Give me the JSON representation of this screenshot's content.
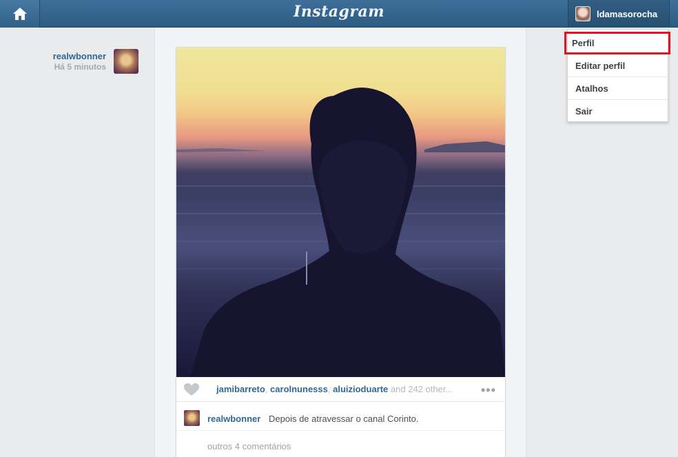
{
  "header": {
    "brand": "Instagram",
    "home_icon": "home-icon",
    "username": "ldamasorocha"
  },
  "user_menu": {
    "items": [
      {
        "label": "Perfil",
        "highlighted": true
      },
      {
        "label": "Editar perfil"
      },
      {
        "label": "Atalhos"
      },
      {
        "label": "Sair"
      }
    ],
    "highlight_color": "#e4121f"
  },
  "post": {
    "author": "realwbonner",
    "time_ago": "Há 5 minutos",
    "likers": [
      "jamibarreto",
      "carolnunesss",
      "aluizioduarte"
    ],
    "likes_suffix": "and 242 other...",
    "more_icon": "ellipsis-icon",
    "like_icon": "heart-icon",
    "comment": {
      "user": "realwbonner",
      "text": "Depois de atravessar o canal Corinto."
    },
    "other_comments": "outros 4 comentários"
  },
  "colors": {
    "topbar": "#2c5b83",
    "link": "#2f6894",
    "background": "#eaebec"
  }
}
